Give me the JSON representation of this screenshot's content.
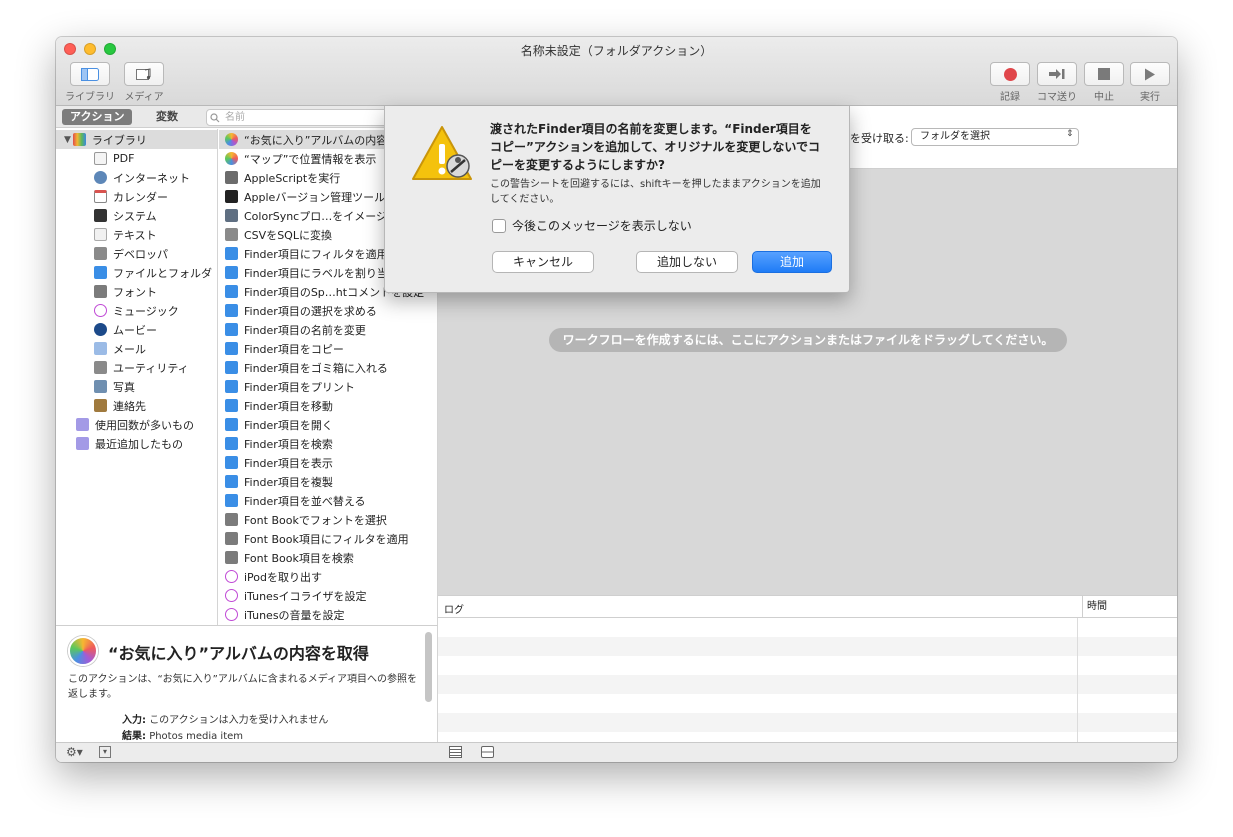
{
  "window": {
    "title": "名称未設定（フォルダアクション）",
    "traffic_colors": [
      "#ff5f57",
      "#febc2e",
      "#28c840"
    ]
  },
  "toolbar": {
    "library_label": "ライブラリ",
    "media_label": "メディア",
    "record_label": "記録",
    "step_label": "コマ送り",
    "stop_label": "中止",
    "run_label": "実行"
  },
  "tabs": {
    "actions": "アクション",
    "variables": "変数"
  },
  "search": {
    "placeholder": "名前"
  },
  "library": {
    "items": [
      "ライブラリ",
      "PDF",
      "インターネット",
      "カレンダー",
      "システム",
      "テキスト",
      "デベロッパ",
      "ファイルとフォルダ",
      "フォント",
      "ミュージック",
      "ムービー",
      "メール",
      "ユーティリティ",
      "写真",
      "連絡先",
      "使用回数が多いもの",
      "最近追加したもの"
    ]
  },
  "actions": {
    "items": [
      "“お気に入り”アルバムの内容を取得",
      "“マップ”で位置情報を表示",
      "AppleScriptを実行",
      "Appleバージョン管理ツール",
      "ColorSyncプロ…をイメージに適用",
      "CSVをSQLに変換",
      "Finder項目にフィルタを適用",
      "Finder項目にラベルを割り当てる",
      "Finder項目のSp…htコメントを設定",
      "Finder項目の選択を求める",
      "Finder項目の名前を変更",
      "Finder項目をコピー",
      "Finder項目をゴミ箱に入れる",
      "Finder項目をプリント",
      "Finder項目を移動",
      "Finder項目を開く",
      "Finder項目を検索",
      "Finder項目を表示",
      "Finder項目を複製",
      "Finder項目を並べ替える",
      "Font Bookでフォントを選択",
      "Font Book項目にフィルタを適用",
      "Font Book項目を検索",
      "iPodを取り出す",
      "iTunesイコライザを設定",
      "iTunesの音量を設定"
    ]
  },
  "description": {
    "title": "“お気に入り”アルバムの内容を取得",
    "text": "このアクションは、“お気に入り”アルバムに含まれるメディア項目への参照を返します。",
    "input_label": "入力:",
    "input_value": "このアクションは入力を受け入れません",
    "result_label": "結果:",
    "result_value": "Photos media item"
  },
  "workflow": {
    "receive_label": "を受け取る:",
    "receive_value": "フォルダを選択",
    "drop_hint": "ワークフローを作成するには、ここにアクションまたはファイルをドラッグしてください。"
  },
  "log": {
    "col_log": "ログ",
    "col_time": "時間"
  },
  "sheet": {
    "title": "渡されたFinder項目の名前を変更します。“Finder項目をコピー”アクションを追加して、オリジナルを変更しないでコピーを変更するようにしますか?",
    "body": "この警告シートを回避するには、shiftキーを押したままアクションを追加してください。",
    "checkbox_label": "今後このメッセージを表示しない",
    "cancel": "キャンセル",
    "dont_add": "追加しない",
    "add": "追加"
  },
  "colors": {
    "accent": "#1f7cf6",
    "record_red": "#e0464a"
  }
}
